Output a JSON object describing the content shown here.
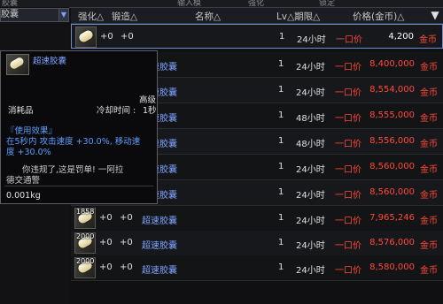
{
  "top": {
    "left": "胶囊",
    "tabs": [
      "输入模",
      "强化",
      "锁定"
    ]
  },
  "filter": {
    "dropdown": "胶囊",
    "button": "▼"
  },
  "header": {
    "enhance": "强化△",
    "forge": "锻造△",
    "name": "名称△",
    "lv_dur": "Lv△期限△",
    "price": "价格(金币)△",
    "sort": "▼"
  },
  "rows": [
    {
      "enh": "+0",
      "frg": "+0",
      "name": "",
      "lv": "1",
      "time": "24小时",
      "price_label": "一口价",
      "price": "4,200",
      "unit": "金币",
      "qty": ""
    },
    {
      "enh": "",
      "frg": "",
      "name": "超速胶囊",
      "lv": "1",
      "time": "24小时",
      "price_label": "一口价",
      "price": "8,400,000",
      "unit": "金币",
      "qty": ""
    },
    {
      "enh": "",
      "frg": "",
      "name": "超速胶囊",
      "lv": "1",
      "time": "24小时",
      "price_label": "一口价",
      "price": "8,554,000",
      "unit": "金币",
      "qty": ""
    },
    {
      "enh": "",
      "frg": "",
      "name": "超速胶囊",
      "lv": "1",
      "time": "48小时",
      "price_label": "一口价",
      "price": "8,555,000",
      "unit": "金币",
      "qty": ""
    },
    {
      "enh": "",
      "frg": "",
      "name": "超速胶囊",
      "lv": "1",
      "time": "48小时",
      "price_label": "一口价",
      "price": "8,556,000",
      "unit": "金币",
      "qty": ""
    },
    {
      "enh": "",
      "frg": "",
      "name": "超速胶囊",
      "lv": "1",
      "time": "24小时",
      "price_label": "一口价",
      "price": "8,560,000",
      "unit": "金币",
      "qty": ""
    },
    {
      "enh": "",
      "frg": "",
      "name": "超速胶囊",
      "lv": "1",
      "time": "24小时",
      "price_label": "一口价",
      "price": "8,560,000",
      "unit": "金币",
      "qty": ""
    },
    {
      "enh": "+0",
      "frg": "+0",
      "name": "超速胶囊",
      "lv": "1",
      "time": "24小时",
      "price_label": "一口价",
      "price": "7,965,246",
      "unit": "金币",
      "qty": "1858"
    },
    {
      "enh": "+0",
      "frg": "+0",
      "name": "超速胶囊",
      "lv": "1",
      "time": "24小时",
      "price_label": "一口价",
      "price": "8,576,000",
      "unit": "金币",
      "qty": "2000"
    },
    {
      "enh": "+0",
      "frg": "+0",
      "name": "超速胶囊",
      "lv": "1",
      "time": "24小时",
      "price_label": "一口价",
      "price": "8,580,000",
      "unit": "金币",
      "qty": "2000"
    }
  ],
  "tooltip": {
    "name": "超速胶囊",
    "grade": "高级",
    "type": "消耗品",
    "cooldown_label": "冷却时间 : ",
    "cooldown_value": "1秒",
    "effect_title": "『使用效果』",
    "effect_line1": "在5秒内 攻击速度 +30.0%, 移动速",
    "effect_line2": "度 +30.0%",
    "desc_line1": "你违规了,这是罚单!  一阿拉",
    "desc_line2": "德交通警",
    "weight": "0.001kg"
  },
  "colors": {
    "name_blue": "#7fa3ff",
    "price_red": "#ff4a3a",
    "select_border": "#6d8fd1"
  }
}
